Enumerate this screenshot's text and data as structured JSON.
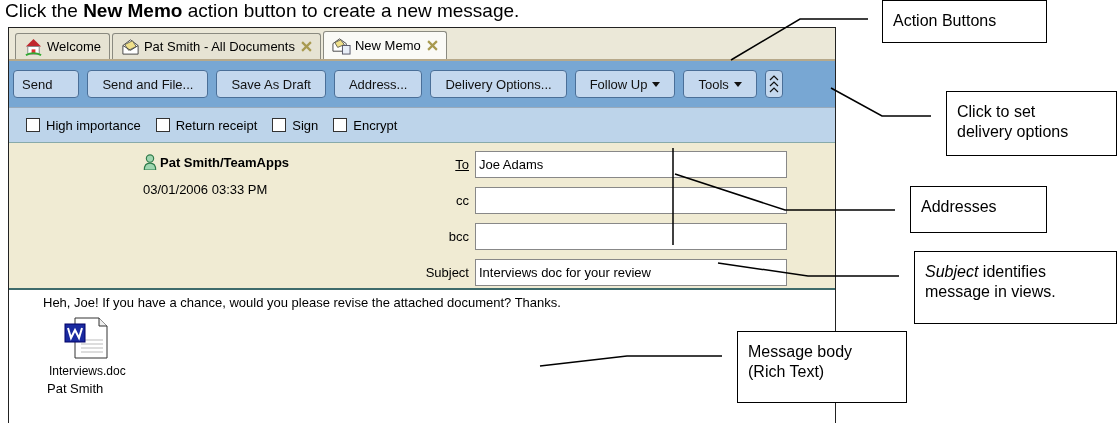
{
  "instruction": "Click the **New Memo** action button to create a new message.",
  "tabs": [
    {
      "label": "Welcome",
      "kind": "home",
      "closable": false,
      "selected": false
    },
    {
      "label": "Pat Smith - All Documents",
      "kind": "mail",
      "closable": true,
      "selected": false
    },
    {
      "label": "New Memo",
      "kind": "memo",
      "closable": true,
      "selected": true
    }
  ],
  "actions": [
    {
      "kind": "plain",
      "label": "Send"
    },
    {
      "kind": "plain",
      "label": "Send and File..."
    },
    {
      "kind": "plain",
      "label": "Save As Draft"
    },
    {
      "kind": "plain",
      "label": "Address..."
    },
    {
      "kind": "plain",
      "label": "Delivery Options..."
    },
    {
      "kind": "dropdown",
      "label": "Follow Up"
    },
    {
      "kind": "dropdown",
      "label": "Tools"
    },
    {
      "kind": "collapse"
    }
  ],
  "options": [
    {
      "label": "High importance",
      "checked": false
    },
    {
      "label": "Return receipt",
      "checked": false
    },
    {
      "label": "Sign",
      "checked": false
    },
    {
      "label": "Encrypt",
      "checked": false
    }
  ],
  "sender": {
    "name": "Pat Smith/TeamApps",
    "date": "03/01/2006 03:33 PM"
  },
  "fields": [
    {
      "label": "To",
      "link": true,
      "value": "Joe Adams"
    },
    {
      "label": "cc",
      "link": false
    },
    {
      "label": "bcc",
      "link": false
    },
    {
      "label": "Subject",
      "link": false,
      "value": "Interviews doc for your review"
    }
  ],
  "body": {
    "text": "Heh, Joe!  If you have a chance, would you please revise the attached document? Thanks.",
    "attachment": "Interviews.doc",
    "signature": "Pat Smith"
  },
  "callouts": [
    {
      "text": "Action Buttons"
    },
    {
      "text": "Click to set delivery options"
    },
    {
      "text": "Addresses"
    },
    {
      "text": "*Subject*  identifies message in views."
    },
    {
      "text": "Message body (Rich Text)"
    }
  ]
}
